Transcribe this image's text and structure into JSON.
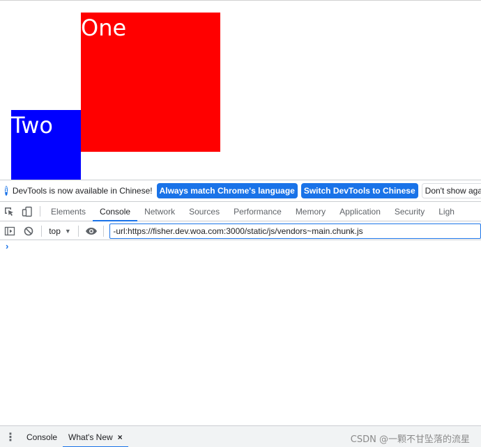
{
  "page": {
    "box_one_label": "One",
    "box_two_label": "Two",
    "colors": {
      "box_one": "#ff0000",
      "box_two": "#0000ff"
    }
  },
  "infobar": {
    "icon": "info-icon",
    "icon_glyph": "i",
    "message": "DevTools is now available in Chinese!",
    "match_language_label": "Always match Chrome's language",
    "switch_label": "Switch DevTools to Chinese",
    "dismiss_label": "Don't show again"
  },
  "tabs": [
    {
      "label": "Elements"
    },
    {
      "label": "Console"
    },
    {
      "label": "Network"
    },
    {
      "label": "Sources"
    },
    {
      "label": "Performance"
    },
    {
      "label": "Memory"
    },
    {
      "label": "Application"
    },
    {
      "label": "Security"
    },
    {
      "label": "Ligh"
    }
  ],
  "active_tab": "Console",
  "console_toolbar": {
    "context": "top",
    "filter_value": "-url:https://fisher.dev.woa.com:3000/static/js/vendors~main.chunk.js"
  },
  "console": {
    "prompt_glyph": "›"
  },
  "drawer": {
    "menu_glyph": "⋮",
    "tabs": [
      {
        "label": "Console"
      },
      {
        "label": "What's New"
      }
    ],
    "active_tab": "What's New",
    "close_glyph": "×",
    "watermark": "CSDN @一颗不甘坠落的流星"
  },
  "accent_color": "#1a73e8"
}
